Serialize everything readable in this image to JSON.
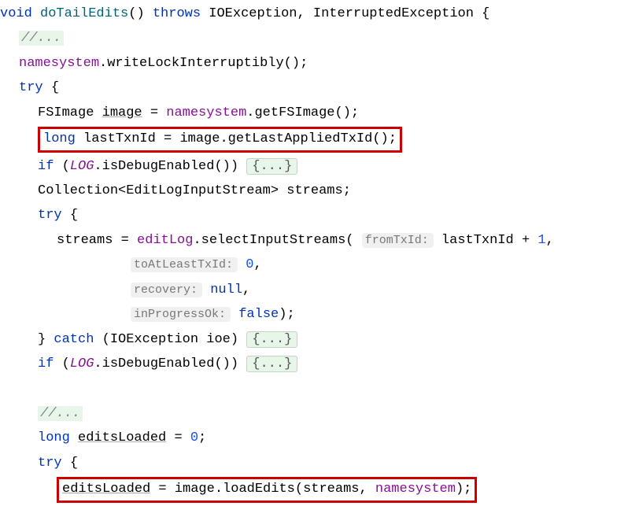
{
  "tokens": {
    "void": "void",
    "throws": "throws",
    "long": "long",
    "if": "if",
    "try": "try",
    "catch": "catch",
    "null": "null",
    "false": "false"
  },
  "names": {
    "method": "doTailEdits",
    "ioexception": "IOException",
    "interrupted": "InterruptedException",
    "namesystem": "namesystem",
    "writeLock": "writeLockInterruptibly",
    "fsimage": "FSImage",
    "image": "image",
    "getFSImage": "getFSImage",
    "lastTxnId": "lastTxnId",
    "getLastApplied": "getLastAppliedTxId",
    "LOG": "LOG",
    "isDebugEnabled": "isDebugEnabled",
    "collection": "Collection",
    "editLogInputStream": "EditLogInputStream",
    "streams": "streams",
    "editLog": "editLog",
    "selectInputStreams": "selectInputStreams",
    "ioe": "ioe",
    "editsLoaded": "editsLoaded",
    "loadEdits": "loadEdits"
  },
  "hints": {
    "fromTxId": "fromTxId:",
    "toAtLeastTxId": "toAtLeastTxId:",
    "recovery": "recovery:",
    "inProgressOk": "inProgressOk:"
  },
  "literals": {
    "zero": "0",
    "one": "1",
    "plus": "+"
  },
  "folds": {
    "ellipsis": "{...}",
    "comment": "//..."
  },
  "punct": {
    "lparen": "(",
    "rparen": ")",
    "lbrace": "{",
    "rbrace": "}",
    "lt": "<",
    "gt": ">",
    "semi": ";",
    "comma": ",",
    "dot": ".",
    "eq": "=",
    "space": " "
  }
}
